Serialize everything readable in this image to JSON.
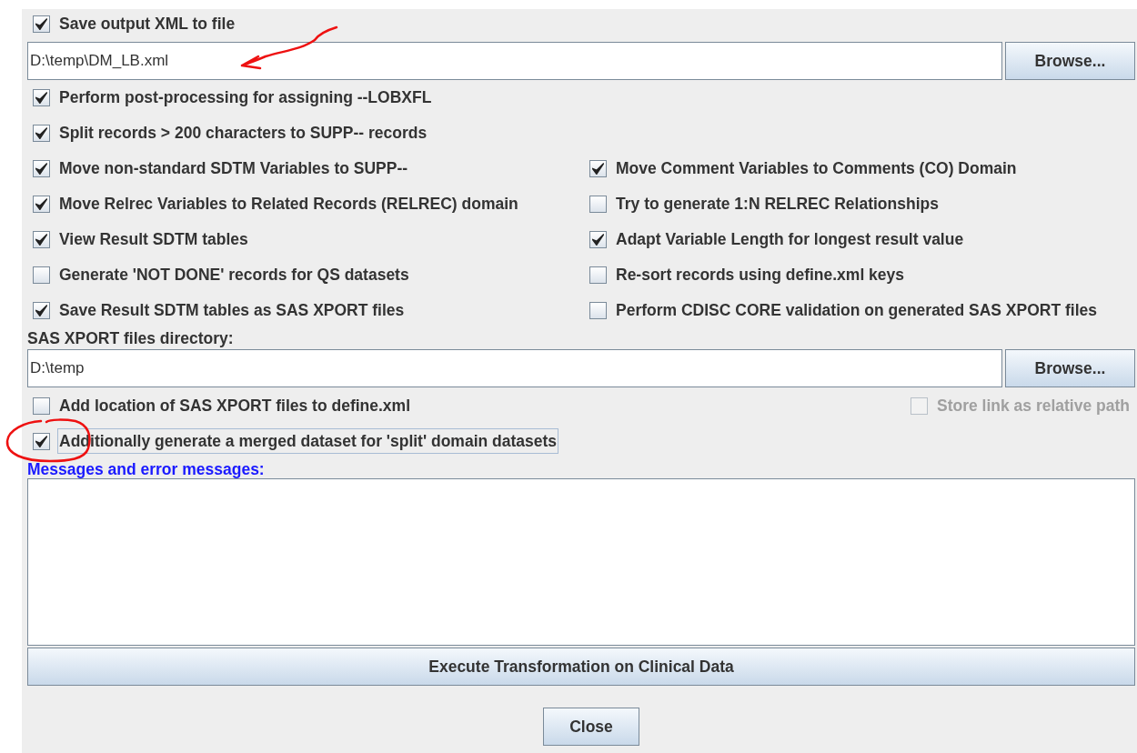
{
  "save_xml": {
    "label": "Save output XML to file",
    "checked": true
  },
  "xml_path": {
    "value": "D:\\temp\\DM_LB.xml",
    "button": "Browse..."
  },
  "single_options": [
    {
      "label": "Perform post-processing for assigning --LOBXFL",
      "checked": true
    },
    {
      "label": "Split records > 200 characters to SUPP-- records",
      "checked": true
    }
  ],
  "paired_options": [
    {
      "left": {
        "label": "Move non-standard SDTM Variables to SUPP--",
        "checked": true
      },
      "right": {
        "label": "Move Comment Variables to Comments (CO) Domain",
        "checked": true
      }
    },
    {
      "left": {
        "label": "Move Relrec Variables to Related Records (RELREC) domain",
        "checked": true
      },
      "right": {
        "label": "Try to generate 1:N RELREC Relationships",
        "checked": false
      }
    },
    {
      "left": {
        "label": "View Result SDTM tables",
        "checked": true
      },
      "right": {
        "label": "Adapt Variable Length for longest result value",
        "checked": true
      }
    },
    {
      "left": {
        "label": "Generate 'NOT DONE' records for QS datasets",
        "checked": false
      },
      "right": {
        "label": "Re-sort records using define.xml keys",
        "checked": false
      }
    },
    {
      "left": {
        "label": "Save Result SDTM tables as SAS XPORT files",
        "checked": true
      },
      "right": {
        "label": "Perform CDISC CORE validation on generated SAS XPORT files",
        "checked": false
      }
    }
  ],
  "xport_label": "SAS XPORT files directory:",
  "xport_path": {
    "value": "D:\\temp",
    "button": "Browse..."
  },
  "add_location": {
    "label": "Add location of SAS XPORT files to define.xml",
    "checked": false
  },
  "relative_path": {
    "label": "Store link as relative path",
    "checked": false,
    "disabled": true
  },
  "merged": {
    "label": "Additionally generate a merged dataset for 'split' domain datasets",
    "checked": true,
    "focused": true
  },
  "messages": {
    "label": "Messages and error messages:"
  },
  "execute_button": "Execute Transformation on Clinical Data",
  "close_button": "Close"
}
